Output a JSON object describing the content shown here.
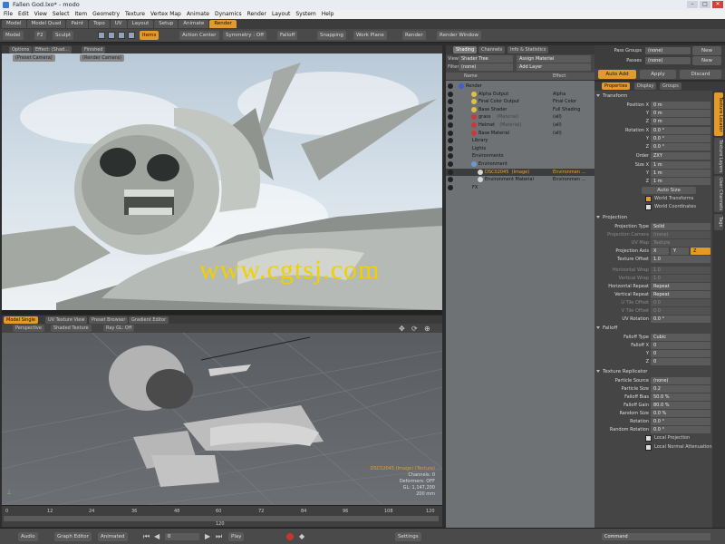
{
  "window": {
    "title": "Fallen God.lxo* - modo"
  },
  "menu": [
    "File",
    "Edit",
    "View",
    "Select",
    "Item",
    "Geometry",
    "Texture",
    "Vertex Map",
    "Animate",
    "Dynamics",
    "Render",
    "Layout",
    "System",
    "Help"
  ],
  "layout_tabs": [
    "Model",
    "Model Quad",
    "Paint",
    "Topo",
    "UV",
    "Layout",
    "Setup",
    "Animate",
    "Render"
  ],
  "layout_active": "Render",
  "toolbar": {
    "model": "Model",
    "f2": "F2",
    "sculpt": "Sculpt",
    "items": "Items",
    "action_center": "Action Center",
    "symmetry": "Symmetry : Off",
    "falloff": "Falloff",
    "snapping": "Snapping",
    "work_plane": "Work Plane",
    "render": "Render",
    "render_window": "Render Window"
  },
  "viewport_top": {
    "tabs": [
      "Options",
      "Effect: (Shad...",
      "Finished"
    ],
    "sub": [
      "(Preset Camera)",
      "(Render Camera)"
    ],
    "watermark": "www.cgtsj.com"
  },
  "viewport_bottom": {
    "tabs": [
      "Model Single",
      "UV Texture View",
      "Preset Browser",
      "Gradient Editor"
    ],
    "sub": [
      "Perspective",
      "Shaded Texture",
      "Ray GL: Off"
    ],
    "info": [
      "DSC02045 (Image) (Texture)",
      "Channels: 0",
      "Deformers: OFF",
      "GL: 1,147,200",
      "200 mm"
    ]
  },
  "timeline": {
    "ticks": [
      "0",
      "12",
      "24",
      "36",
      "48",
      "60",
      "72",
      "84",
      "96",
      "108",
      "120"
    ],
    "marker": "120"
  },
  "bottombar": {
    "audio": "Audio",
    "graph_editor": "Graph Editor",
    "animated": "Animated",
    "frame": "0",
    "play": "Play",
    "settings": "Settings",
    "command": "Command"
  },
  "shading": {
    "tabs": [
      "Shading",
      "Channels",
      "Info & Statistics"
    ],
    "view_label": "View",
    "view_value": "Shader Tree",
    "assign_material": "Assign Material",
    "filter_label": "Filter",
    "filter_value": "(none)",
    "add_layer": "Add Layer",
    "col_name": "Name",
    "col_effect": "Effect",
    "rows": [
      {
        "name": "Render",
        "effect": "",
        "indent": 0,
        "ball": "#3a63c8"
      },
      {
        "name": "Alpha Output",
        "effect": "Alpha",
        "indent": 2,
        "ball": "#e0c040"
      },
      {
        "name": "Final Color Output",
        "effect": "Final Color",
        "indent": 2,
        "ball": "#e0c040"
      },
      {
        "name": "Base Shader",
        "effect": "Full Shading",
        "indent": 2,
        "ball": "#e0c040"
      },
      {
        "name": "grass",
        "tag": "(Material)",
        "effect": "(all)",
        "indent": 2,
        "ball": "#c83a3a"
      },
      {
        "name": "Helmet",
        "tag": "(Material)",
        "effect": "(all)",
        "indent": 2,
        "ball": "#c83a3a"
      },
      {
        "name": "Base Material",
        "effect": "(all)",
        "indent": 2,
        "ball": "#c83a3a"
      },
      {
        "name": "Library",
        "effect": "",
        "indent": 1,
        "ball": ""
      },
      {
        "name": "Lights",
        "effect": "",
        "indent": 1,
        "ball": ""
      },
      {
        "name": "Environments",
        "effect": "",
        "indent": 1,
        "ball": ""
      },
      {
        "name": "Environment",
        "effect": "",
        "indent": 2,
        "ball": "#6a9ad6"
      },
      {
        "name": "DSC02045",
        "tag": "(Image)",
        "effect": "Environmen ...",
        "indent": 3,
        "ball": "#d8d8d8",
        "selected": true
      },
      {
        "name": "Environment Material",
        "effect": "Environmen ...",
        "indent": 3,
        "ball": "#d8d8d8"
      },
      {
        "name": "FX",
        "effect": "",
        "indent": 1,
        "ball": ""
      }
    ]
  },
  "properties": {
    "pass_groups_label": "Pass Groups",
    "pass_groups_value": "(none)",
    "passes_label": "Passes",
    "passes_value": "(none)",
    "new1": "New",
    "new2": "New",
    "auto_add": "Auto Add",
    "apply": "Apply",
    "discard": "Discard",
    "tabs": [
      "Properties",
      "Display",
      "Groups"
    ],
    "vtabs": [
      "Texture Locator",
      "Texture Layers",
      "User Channels",
      "Tags"
    ],
    "transform": "Transform",
    "position": {
      "label": "Position",
      "x": "0 m",
      "y": "0 m",
      "z": "0 m"
    },
    "rotation": {
      "label": "Rotation",
      "x": "0.0 °",
      "y": "0.0 °",
      "z": "0.0 °"
    },
    "order": {
      "label": "Order",
      "value": "ZXY"
    },
    "size": {
      "label": "Size",
      "x": "1 m",
      "y": "1 m",
      "z": "1 m"
    },
    "axis": [
      "X",
      "Y",
      "Z"
    ],
    "auto_size": "Auto Size",
    "world_transforms": "World Transforms",
    "world_coordinates": "World Coordinates",
    "projection": "Projection",
    "projection_type": {
      "label": "Projection Type",
      "value": "Solid"
    },
    "projection_camera": {
      "label": "Projection Camera",
      "value": "(none)"
    },
    "uv_map": {
      "label": "UV Map",
      "value": "Texture"
    },
    "projection_axis": {
      "label": "Projection Axis"
    },
    "texture_offset": {
      "label": "Texture Offset",
      "value": "1.0"
    },
    "horizontal_wrap": {
      "label": "Horizontal Wrap",
      "value": "1.0"
    },
    "vertical_wrap": {
      "label": "Vertical Wrap",
      "value": "1.0"
    },
    "horizontal_repeat": {
      "label": "Horizontal Repeat",
      "value": "Repeat"
    },
    "vertical_repeat": {
      "label": "Vertical Repeat",
      "value": "Repeat"
    },
    "u_tile_offset": {
      "label": "U Tile Offset",
      "value": "0.0"
    },
    "v_tile_offset": {
      "label": "V Tile Offset",
      "value": "0.0"
    },
    "uv_rotation": {
      "label": "UV Rotation",
      "value": "0.0 °"
    },
    "falloff": "Falloff",
    "falloff_type": {
      "label": "Falloff Type",
      "value": "Cubic"
    },
    "falloff_xyz": {
      "label": "Falloff",
      "x": "0",
      "y": "0",
      "z": "0"
    },
    "texture_replicator": "Texture Replicator",
    "particle_source": {
      "label": "Particle Source",
      "value": "(none)"
    },
    "particle_size": {
      "label": "Particle Size",
      "value": "0.2"
    },
    "falloff_bias": {
      "label": "Falloff Bias",
      "value": "50.0 %"
    },
    "falloff_gain": {
      "label": "Falloff Gain",
      "value": "80.0 %"
    },
    "random_size": {
      "label": "Random Size",
      "value": "0.0 %"
    },
    "rotation_r": {
      "label": "Rotation",
      "value": "0.0 °"
    },
    "random_rotation": {
      "label": "Random Rotation",
      "value": "0.0 °"
    },
    "local_projection": "Local Projection",
    "local_normal_attenuation": "Local Normal Attenuation"
  }
}
